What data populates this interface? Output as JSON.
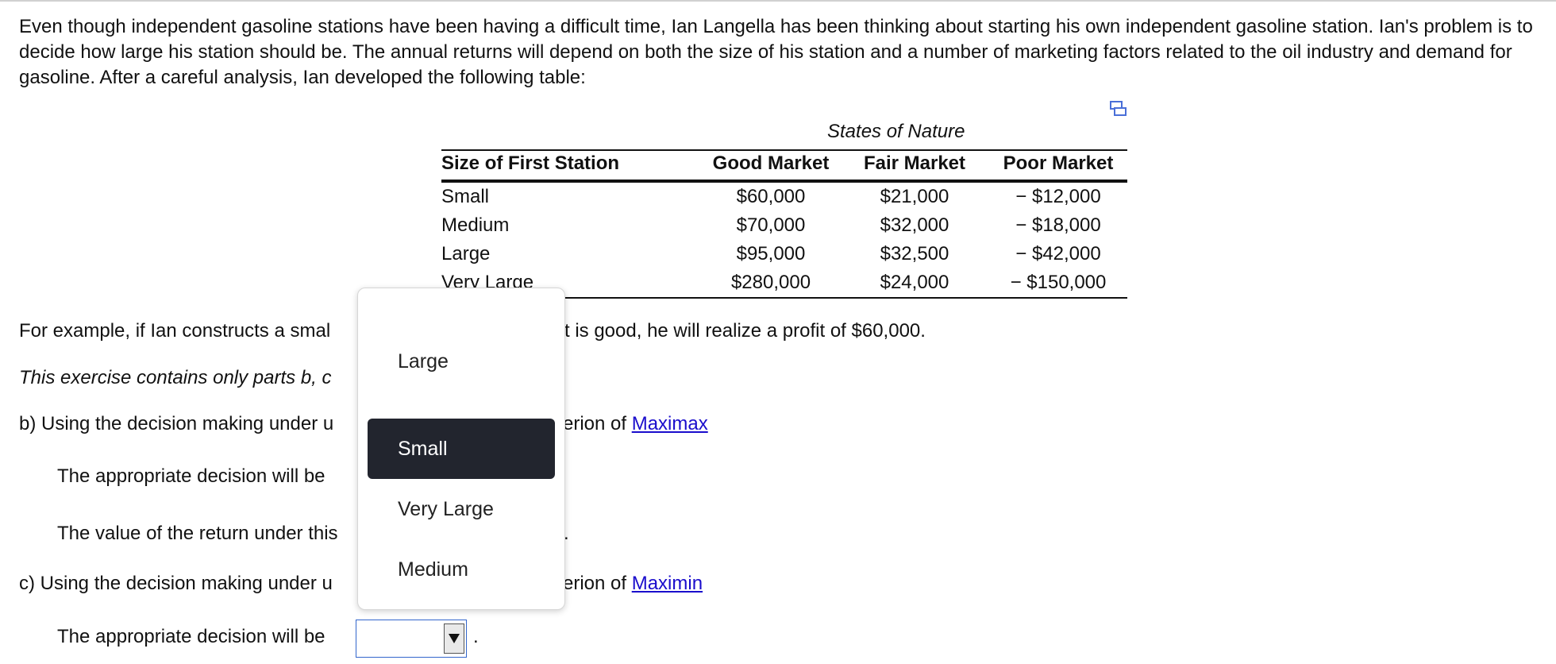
{
  "intro": "Even though independent gasoline stations have been having a difficult time, Ian Langella has been thinking about starting his own independent gasoline station.  Ian's problem is to decide how large his station should be.  The annual returns will depend on both the size of his station and a number of marketing factors related to the oil industry and demand for gasoline.  After a careful analysis, Ian developed the following table:",
  "table": {
    "states_label": "States of Nature",
    "headers": [
      "Size of First Station",
      "Good Market",
      "Fair Market",
      "Poor Market"
    ],
    "rows": [
      {
        "size": "Small",
        "good": "$60,000",
        "fair": "$21,000",
        "poor": "− $12,000"
      },
      {
        "size": "Medium",
        "good": "$70,000",
        "fair": "$32,000",
        "poor": "− $18,000"
      },
      {
        "size": "Large",
        "good": "$95,000",
        "fair": "$32,500",
        "poor": "− $42,000"
      },
      {
        "size": "Very Large",
        "good": "$280,000",
        "fair": "$24,000",
        "poor": "− $150,000"
      }
    ]
  },
  "example": {
    "left": "For example, if Ian constructs a smal",
    "right": "t is good, he will realize a profit of $60,000."
  },
  "exercise_note": "This exercise contains only parts b, c",
  "part_b": {
    "left": "b) Using the decision making under u",
    "right": "erion of ",
    "link": "Maximax",
    "decision_label": "The appropriate decision will be",
    "value_label": "The value of the return under this",
    "value_suffix": "."
  },
  "part_c": {
    "left": "c) Using the decision making under u",
    "right": "erion of ",
    "link": "Maximin",
    "decision_label": "The appropriate decision will be",
    "decision_suffix": "."
  },
  "dropdown": {
    "options": [
      "Large",
      "Small",
      "Very Large",
      "Medium"
    ],
    "selected": "Small"
  },
  "colors": {
    "link": "#1a0dcc",
    "selected_bg": "#22252e",
    "select_border": "#3366cc"
  }
}
